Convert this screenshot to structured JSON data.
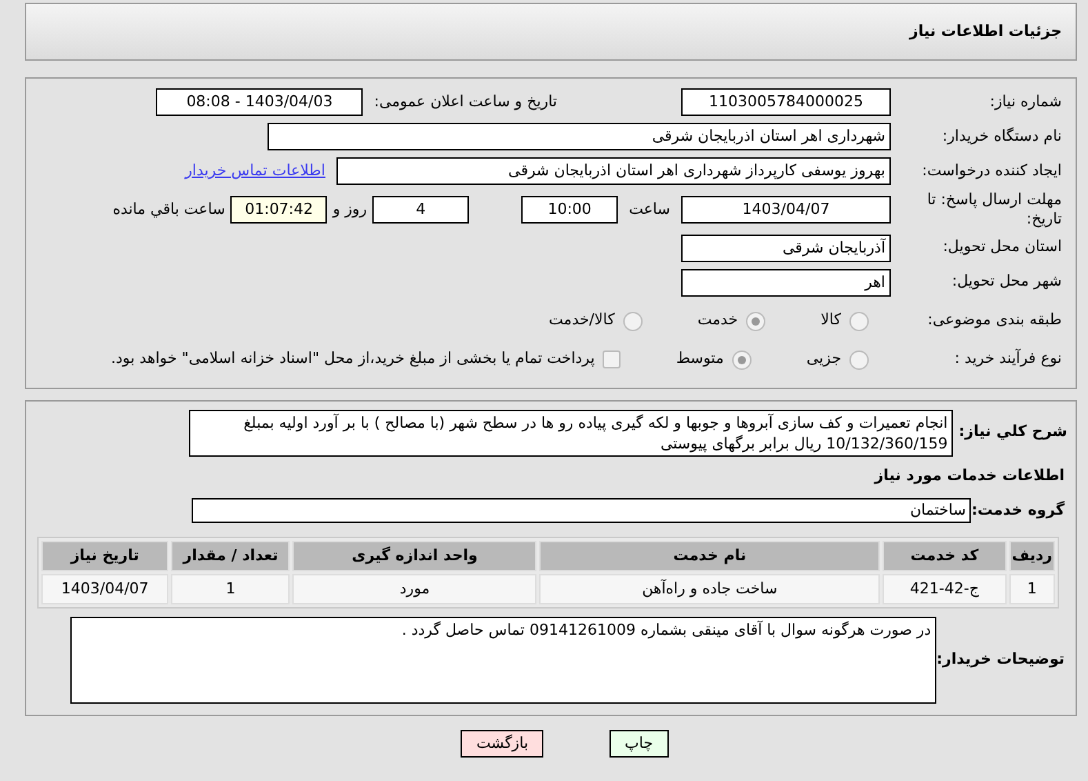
{
  "header": {
    "title": "جزئیات اطلاعات نیاز"
  },
  "details": {
    "need_number": {
      "label": "شماره نیاز:",
      "value": "1103005784000025"
    },
    "announce": {
      "label": "تاریخ و ساعت اعلان عمومی:",
      "value": "1403/04/03 - 08:08"
    },
    "buyer_org": {
      "label": "نام دستگاه خریدار:",
      "value": "شهرداری اهر استان اذربایجان شرقی"
    },
    "creator": {
      "label": "ایجاد کننده درخواست:",
      "value": "بهروز یوسفی کارپرداز شهرداری اهر استان اذربایجان شرقی",
      "link": "اطلاعات تماس خریدار"
    },
    "deadline": {
      "label": "مهلت ارسال پاسخ: تا تاریخ:",
      "date": "1403/04/07",
      "time_label": "ساعت",
      "time": "10:00",
      "days": "4",
      "days_label": "روز و",
      "remaining": "01:07:42",
      "remaining_label": "ساعت باقي مانده"
    },
    "province": {
      "label": "استان محل تحویل:",
      "value": "آذربایجان شرقی"
    },
    "city": {
      "label": "شهر محل تحویل:",
      "value": "اهر"
    },
    "category": {
      "label": "طبقه بندی موضوعی:",
      "options": [
        {
          "label": "کالا",
          "selected": false
        },
        {
          "label": "خدمت",
          "selected": true
        },
        {
          "label": "کالا/خدمت",
          "selected": false
        }
      ]
    },
    "process": {
      "label": "نوع فرآیند خرید :",
      "options": [
        {
          "label": "جزیی",
          "selected": false
        },
        {
          "label": "متوسط",
          "selected": true
        }
      ],
      "treasury": {
        "label": "پرداخت تمام یا بخشی از مبلغ خرید،از محل \"اسناد خزانه اسلامی\" خواهد بود.",
        "checked": false
      }
    }
  },
  "description": {
    "label": "شرح کلي نیاز:",
    "text": "انجام تعمیرات و کف سازی آبروها و جوبها و لکه گیری پیاده رو ها در سطح شهر (با مصالح ) با بر آورد اولیه بمبلغ 10/132/360/159 ریال برابر برگهای پیوستی"
  },
  "services": {
    "heading": "اطلاعات خدمات مورد نیاز",
    "group_label": "گروه خدمت:",
    "group": "ساختمان",
    "table": {
      "columns": [
        "ردیف",
        "کد خدمت",
        "نام خدمت",
        "واحد اندازه گیری",
        "تعداد / مقدار",
        "تاریخ نیاز"
      ],
      "rows": [
        [
          "1",
          "ج-42-421",
          "ساخت جاده و راه‌آهن",
          "مورد",
          "1",
          "1403/04/07"
        ]
      ]
    }
  },
  "buyer_notes": {
    "label": "توضیحات خریدار:",
    "text": "در صورت هرگونه سوال با آقای مینقی بشماره  09141261009 تماس حاصل گردد ."
  },
  "buttons": [
    {
      "label": "چاپ",
      "kind": "print"
    },
    {
      "label": "بازگشت",
      "kind": "back"
    }
  ]
}
